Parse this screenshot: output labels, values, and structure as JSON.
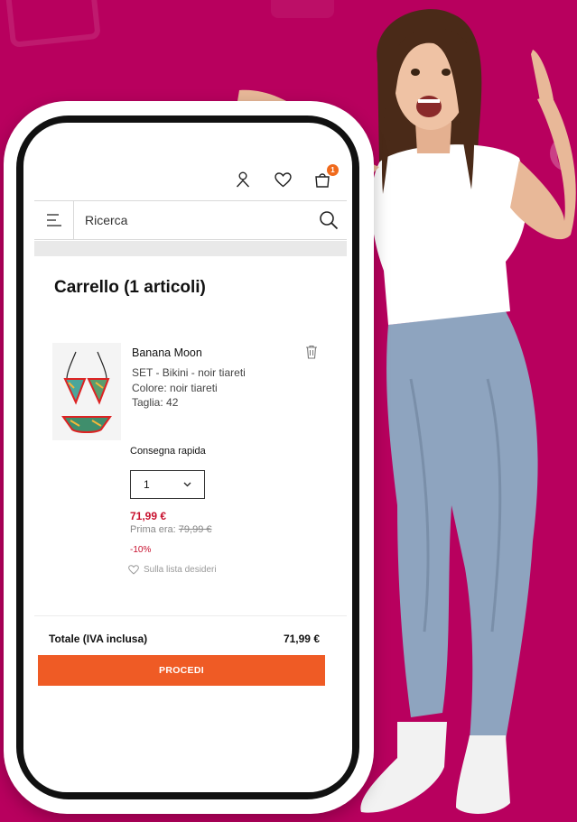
{
  "header": {
    "icons": [
      "user-icon",
      "heart-icon",
      "bag-icon"
    ],
    "cart_badge": "1"
  },
  "search": {
    "placeholder": "Ricerca"
  },
  "cart": {
    "title": "Carrello (1 articoli)",
    "item": {
      "brand": "Banana Moon",
      "name": "SET - Bikini - noir tiareti",
      "color": "Colore: noir tiareti",
      "size": "Taglia: 42",
      "delivery": "Consegna rapida",
      "quantity": "1",
      "price": "71,99 €",
      "old_price_label": "Prima era: ",
      "old_price": "79,99 €",
      "discount": "-10%",
      "wishlist_label": "Sulla lista desideri"
    },
    "total_label": "Totale (IVA inclusa)",
    "total_value": "71,99 €",
    "proceed_label": "PROCEDI"
  },
  "colors": {
    "background": "#b8005e",
    "accent": "#ef5b25",
    "price_red": "#c8102e",
    "badge": "#f06a1c"
  }
}
